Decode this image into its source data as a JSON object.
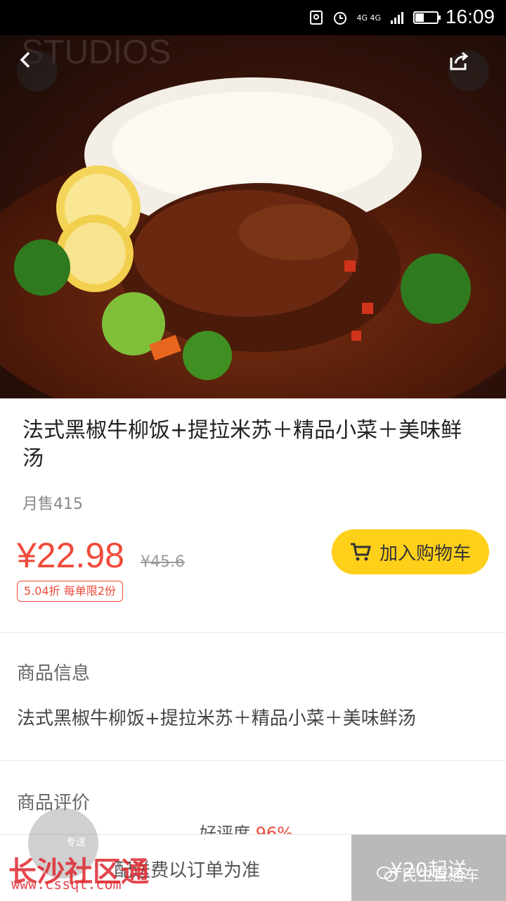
{
  "status_bar": {
    "network": "4G 4G",
    "time": "16:09"
  },
  "hero": {
    "backdrop_text": "STUDIOS"
  },
  "product": {
    "title": "法式黑椒牛柳饭+提拉米苏＋精品小菜＋美味鲜汤",
    "monthly_sales": "月售415",
    "price": "¥22.98",
    "original_price": "¥45.6",
    "discount_tag": "5.04折 每单限2份",
    "add_to_cart_label": "加入购物车"
  },
  "sections": {
    "info_title": "商品信息",
    "info_body": "法式黑椒牛柳饭+提拉米苏＋精品小菜＋美味鲜汤",
    "reviews_title": "商品评价",
    "rating_label": "好评度",
    "rating_value": "96%"
  },
  "bottom_bar": {
    "delivery_badge": "专送",
    "delivery_note": "配送费以订单为准",
    "min_order": "¥20起送"
  },
  "watermarks": {
    "left_text": "长沙社区通",
    "left_url": "www.cssqt.com",
    "right_text": "民生直通车"
  },
  "colors": {
    "accent_red": "#f04a3a",
    "cart_yellow": "#ffd01a",
    "min_order_gray": "#b9b9b9"
  }
}
